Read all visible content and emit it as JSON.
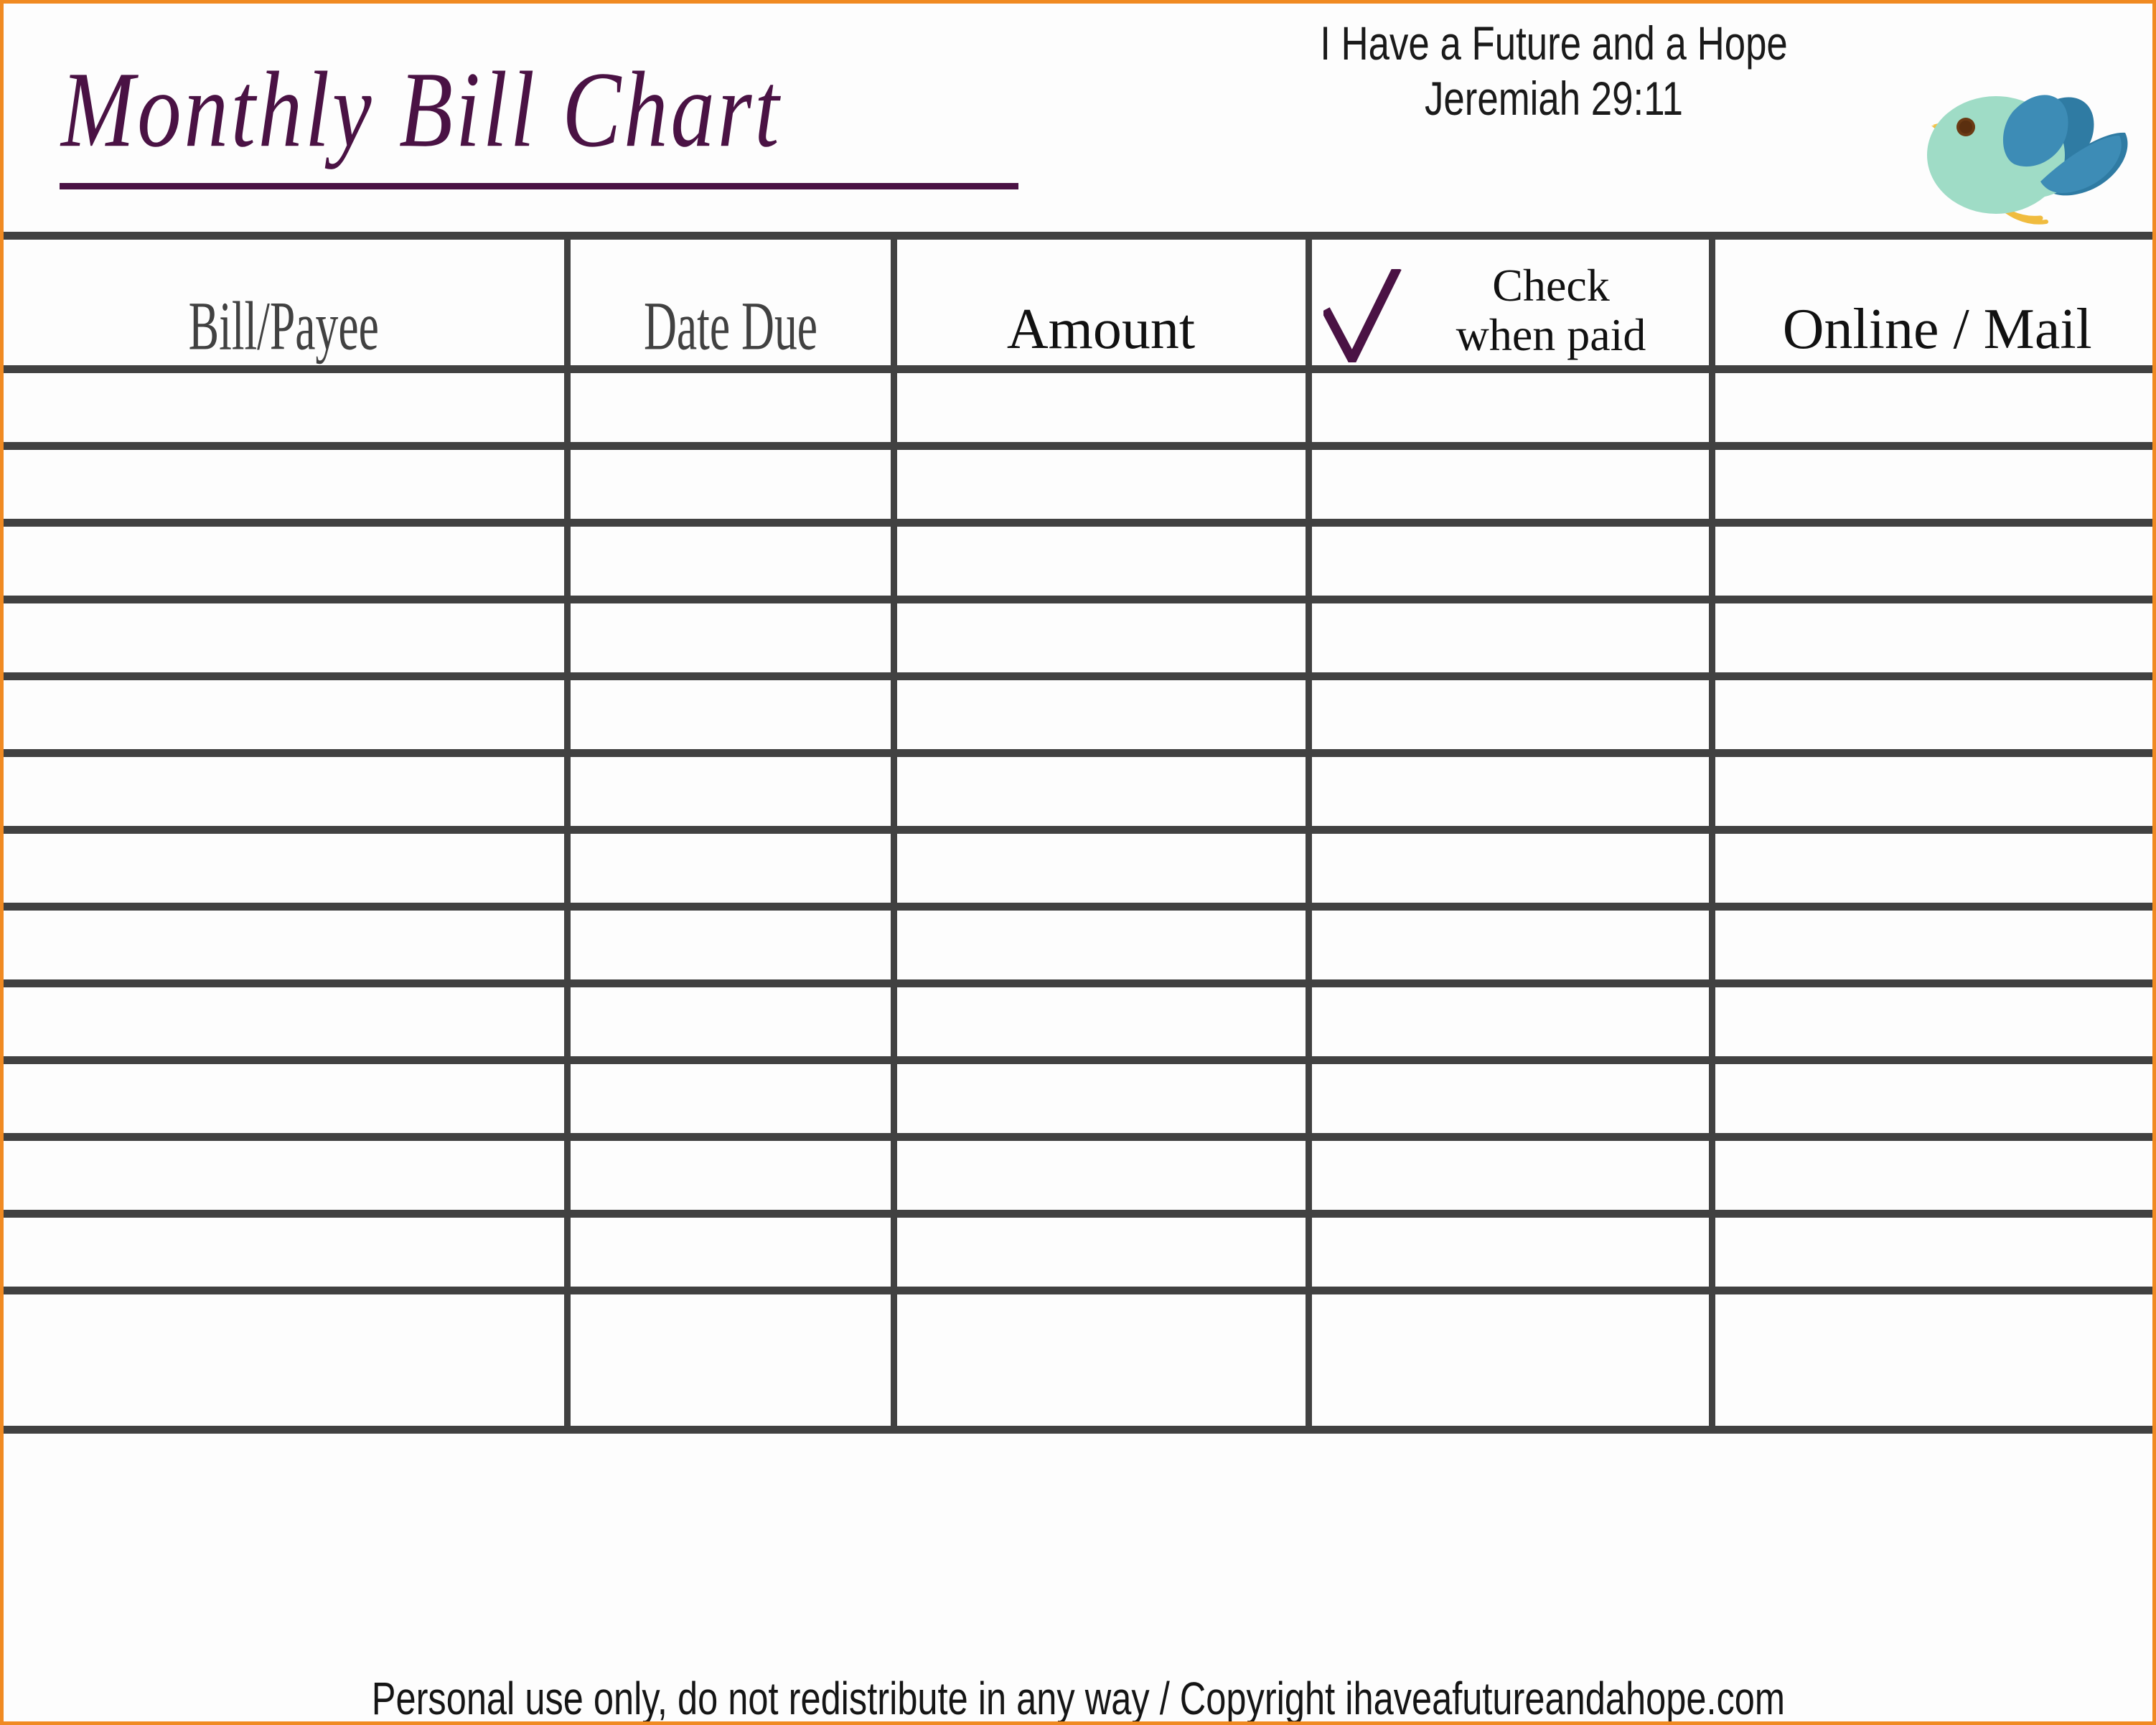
{
  "page": {
    "border_color": "#f08a22",
    "background": "#fdfdfd"
  },
  "header": {
    "title": "Monthly Bill Chart",
    "title_color": "#4a1244",
    "tagline_line1": "I Have a Future and a Hope",
    "tagline_line2": "Jeremiah 29:11",
    "bird_icon": "bird-icon",
    "bird_colors": {
      "body": "#9fdcc6",
      "wing_front": "#3d8cb6",
      "wing_back": "#2f7ba3",
      "beak": "#f6c344",
      "legs": "#f0bc3f",
      "eye": "#6b3a14"
    }
  },
  "table": {
    "columns": [
      {
        "key": "bill",
        "label": "Bill/Payee",
        "style": "condensed"
      },
      {
        "key": "date",
        "label": "Date Due",
        "style": "condensed"
      },
      {
        "key": "amount",
        "label": "Amount",
        "style": "plain"
      },
      {
        "key": "check",
        "label": "Check when paid",
        "style": "check",
        "label_line1": "Check",
        "label_line2": "when paid",
        "icon": "checkmark-icon",
        "icon_color": "#4a1244"
      },
      {
        "key": "online",
        "label": "Online / Mail",
        "style": "plain"
      }
    ],
    "grid_color": "#414141",
    "row_count": 13,
    "rows": [
      {
        "bill": "",
        "date": "",
        "amount": "",
        "check": "",
        "online": ""
      },
      {
        "bill": "",
        "date": "",
        "amount": "",
        "check": "",
        "online": ""
      },
      {
        "bill": "",
        "date": "",
        "amount": "",
        "check": "",
        "online": ""
      },
      {
        "bill": "",
        "date": "",
        "amount": "",
        "check": "",
        "online": ""
      },
      {
        "bill": "",
        "date": "",
        "amount": "",
        "check": "",
        "online": ""
      },
      {
        "bill": "",
        "date": "",
        "amount": "",
        "check": "",
        "online": ""
      },
      {
        "bill": "",
        "date": "",
        "amount": "",
        "check": "",
        "online": ""
      },
      {
        "bill": "",
        "date": "",
        "amount": "",
        "check": "",
        "online": ""
      },
      {
        "bill": "",
        "date": "",
        "amount": "",
        "check": "",
        "online": ""
      },
      {
        "bill": "",
        "date": "",
        "amount": "",
        "check": "",
        "online": ""
      },
      {
        "bill": "",
        "date": "",
        "amount": "",
        "check": "",
        "online": ""
      },
      {
        "bill": "",
        "date": "",
        "amount": "",
        "check": "",
        "online": ""
      },
      {
        "bill": "",
        "date": "",
        "amount": "",
        "check": "",
        "online": ""
      }
    ]
  },
  "footer": {
    "text": "Personal use only, do not redistribute in any way / Copyright ihaveafutureandahope.com"
  }
}
